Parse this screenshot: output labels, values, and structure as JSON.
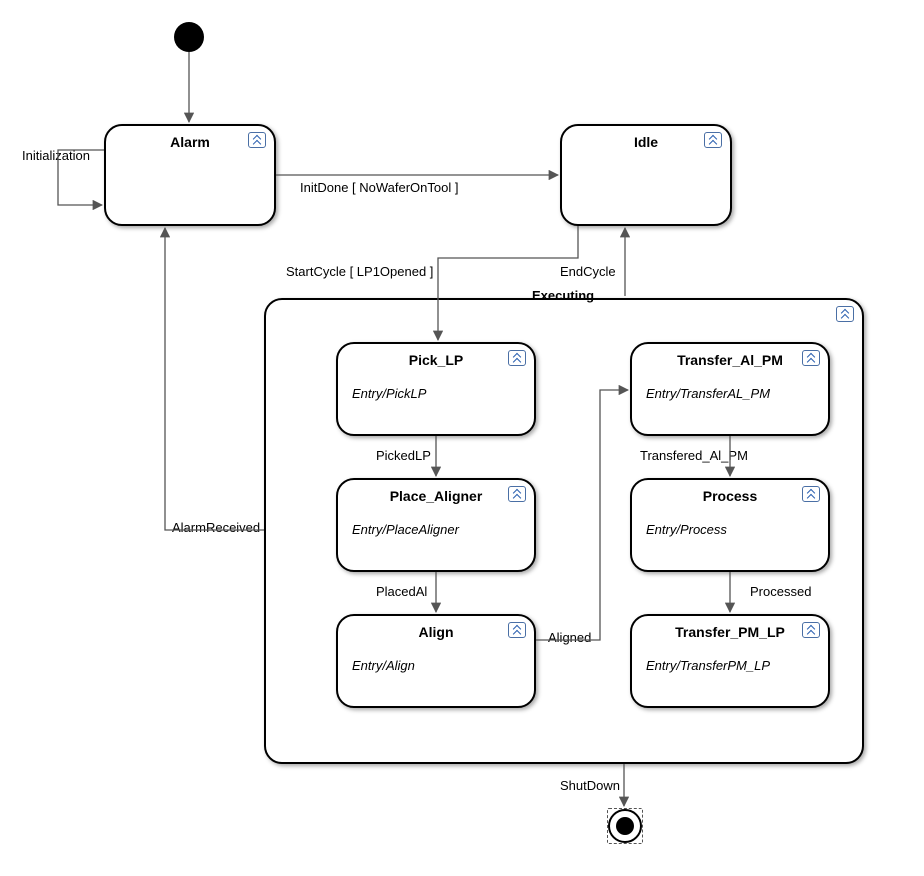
{
  "states": {
    "alarm": {
      "title": "Alarm"
    },
    "idle": {
      "title": "Idle"
    },
    "executing": {
      "title": "Executing"
    },
    "pick_lp": {
      "title": "Pick_LP",
      "entry": "Entry/PickLP"
    },
    "place_aligner": {
      "title": "Place_Aligner",
      "entry": "Entry/PlaceAligner"
    },
    "align": {
      "title": "Align",
      "entry": "Entry/Align"
    },
    "transfer_al_pm": {
      "title": "Transfer_Al_PM",
      "entry": "Entry/TransferAL_PM"
    },
    "process": {
      "title": "Process",
      "entry": "Entry/Process"
    },
    "transfer_pm_lp": {
      "title": "Transfer_PM_LP",
      "entry": "Entry/TransferPM_LP"
    }
  },
  "transitions": {
    "initialization": "Initialization",
    "initdone": "InitDone  [ NoWaferOnTool ]",
    "startcycle": "StartCycle  [ LP1Opened ]",
    "endcycle": "EndCycle",
    "alarmreceived": "AlarmReceived",
    "pickedlp": "PickedLP",
    "placedal": "PlacedAl",
    "aligned": "Aligned",
    "transfered_al_pm": "Transfered_Al_PM",
    "processed": "Processed",
    "shutdown": "ShutDown"
  }
}
